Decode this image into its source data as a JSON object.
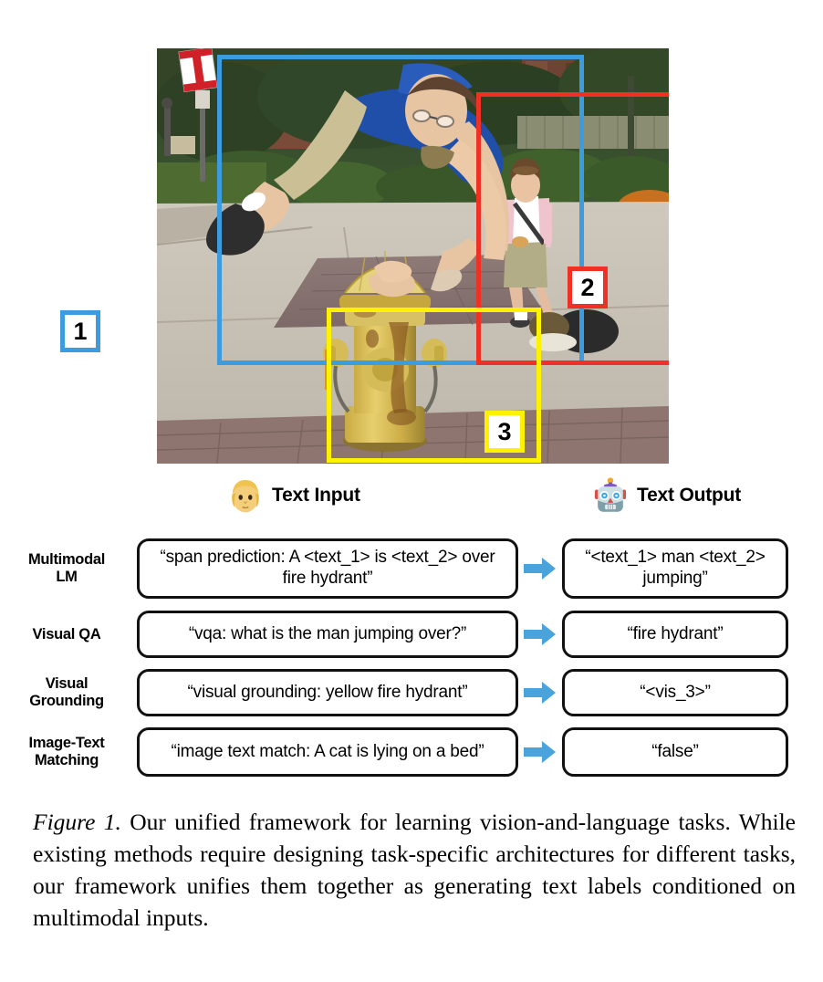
{
  "figure": {
    "number_label": "Figure 1.",
    "caption": " Our unified framework for learning vision-and-language tasks. While existing methods require designing task-specific architectures for different tasks, our framework unifies them together as generating text labels conditioned on multimodal inputs."
  },
  "photo": {
    "description": "A man in a blue t-shirt and khaki shorts jumping over a yellow fire hydrant on a sidewalk, with a woman in a pink shirt standing behind him",
    "boxes": [
      {
        "id": "1",
        "label": "1",
        "color": "#3d9be0",
        "refers_to": "man"
      },
      {
        "id": "2",
        "label": "2",
        "color": "#ee3124",
        "refers_to": "woman"
      },
      {
        "id": "3",
        "label": "3",
        "color": "#fff200",
        "refers_to": "yellow fire hydrant"
      }
    ]
  },
  "diagram": {
    "input_header": {
      "emoji": "person-face-emoji",
      "label": "Text Input"
    },
    "output_header": {
      "emoji": "robot-face-emoji",
      "label": "Text Output"
    },
    "arrow_color": "#4ba3dc",
    "rows": [
      {
        "task": "Multimodal\nLM",
        "task_line1": "Multimodal",
        "task_line2": "LM",
        "input": "“span prediction: A <text_1> is <text_2> over fire hydrant”",
        "output": "“<text_1> man <text_2> jumping”"
      },
      {
        "task": "Visual QA",
        "task_line1": "Visual QA",
        "task_line2": "",
        "input": "“vqa: what is the man jumping over?”",
        "output": "“fire hydrant”"
      },
      {
        "task": "Visual Grounding",
        "task_line1": "Visual",
        "task_line2": "Grounding",
        "input": "“visual grounding: yellow fire hydrant”",
        "output": "“<vis_3>”"
      },
      {
        "task": "Image-Text Matching",
        "task_line1": "Image-Text",
        "task_line2": "Matching",
        "input": "“image text match: A cat is lying on a bed”",
        "output": "“false”"
      }
    ]
  }
}
